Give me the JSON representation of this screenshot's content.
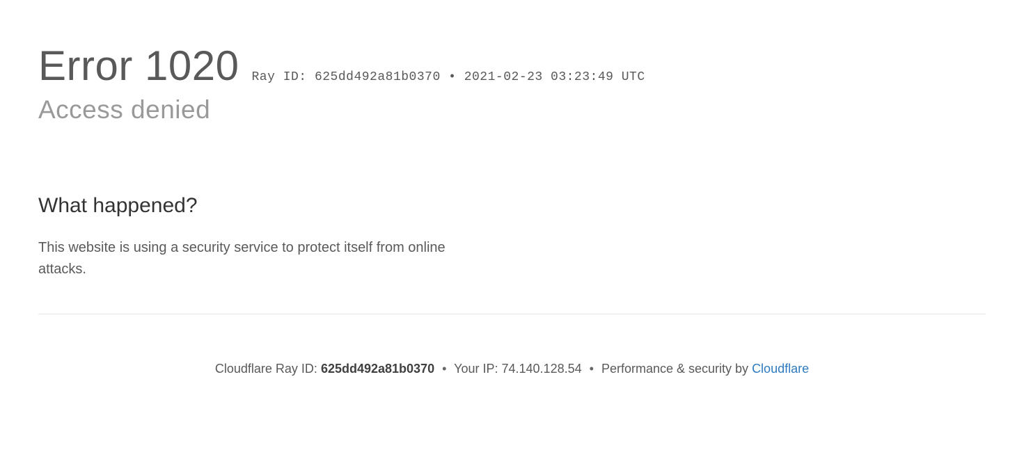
{
  "header": {
    "error_label": "Error",
    "error_code": "1020",
    "ray_label": "Ray ID:",
    "ray_id": "625dd492a81b0370",
    "separator": "•",
    "timestamp": "2021-02-23 03:23:49 UTC"
  },
  "subheading": "Access denied",
  "section": {
    "title": "What happened?",
    "body": "This website is using a security service to protect itself from online attacks."
  },
  "footer": {
    "ray_label": "Cloudflare Ray ID:",
    "ray_id": "625dd492a81b0370",
    "ip_label": "Your IP:",
    "ip": "74.140.128.54",
    "perf_label": "Performance & security by",
    "provider": "Cloudflare",
    "separator": "•"
  }
}
